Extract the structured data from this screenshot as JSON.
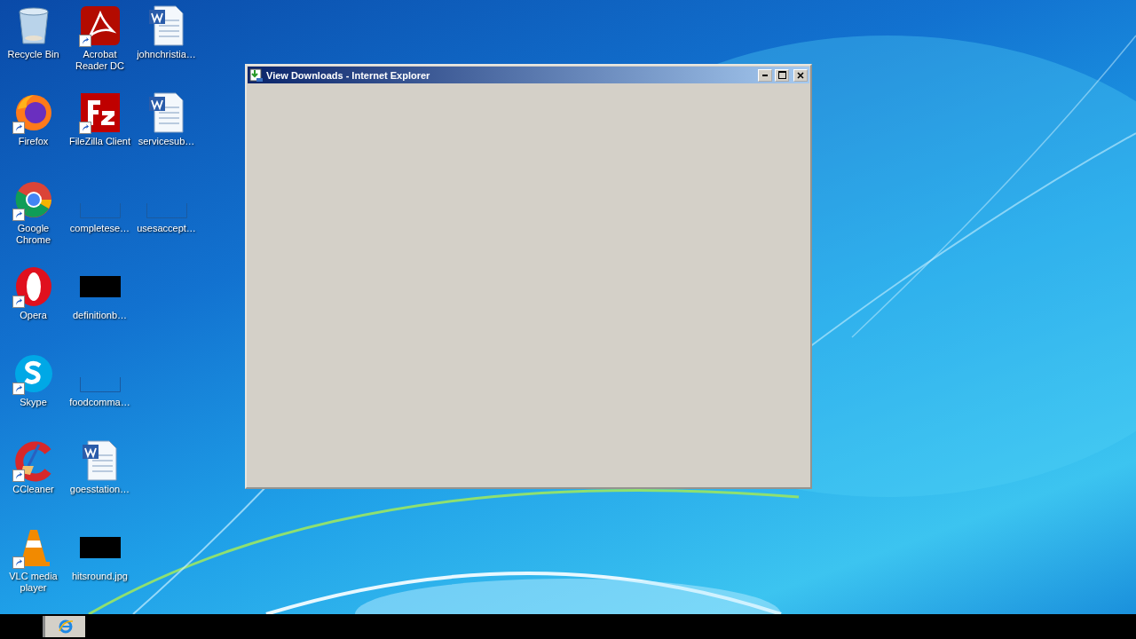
{
  "desktop_icons": [
    {
      "label": "Recycle Bin",
      "kind": "recycle",
      "shortcut": false
    },
    {
      "label": "Firefox",
      "kind": "firefox",
      "shortcut": true
    },
    {
      "label": "Google Chrome",
      "kind": "chrome",
      "shortcut": true
    },
    {
      "label": "Opera",
      "kind": "opera",
      "shortcut": true
    },
    {
      "label": "Skype",
      "kind": "skype",
      "shortcut": true
    },
    {
      "label": "CCleaner",
      "kind": "ccleaner",
      "shortcut": true
    },
    {
      "label": "VLC media player",
      "kind": "vlc",
      "shortcut": true
    },
    {
      "label": "Acrobat Reader DC",
      "kind": "acrobat",
      "shortcut": true
    },
    {
      "label": "FileZilla Client",
      "kind": "filezilla",
      "shortcut": true
    },
    {
      "label": "completese…",
      "kind": "blank",
      "shortcut": false
    },
    {
      "label": "definitionb…",
      "kind": "black",
      "shortcut": false
    },
    {
      "label": "foodcomma…",
      "kind": "blank",
      "shortcut": false
    },
    {
      "label": "goesstation…",
      "kind": "word",
      "shortcut": false
    },
    {
      "label": "hitsround.jpg",
      "kind": "black",
      "shortcut": false
    },
    {
      "label": "johnchristia…",
      "kind": "word",
      "shortcut": false
    },
    {
      "label": "servicesub…",
      "kind": "word",
      "shortcut": false
    },
    {
      "label": "usesaccept…",
      "kind": "blank",
      "shortcut": false
    }
  ],
  "window": {
    "title": "View Downloads - Internet Explorer"
  },
  "taskbar": {
    "items": [
      {
        "kind": "ie",
        "selected": true
      }
    ]
  }
}
